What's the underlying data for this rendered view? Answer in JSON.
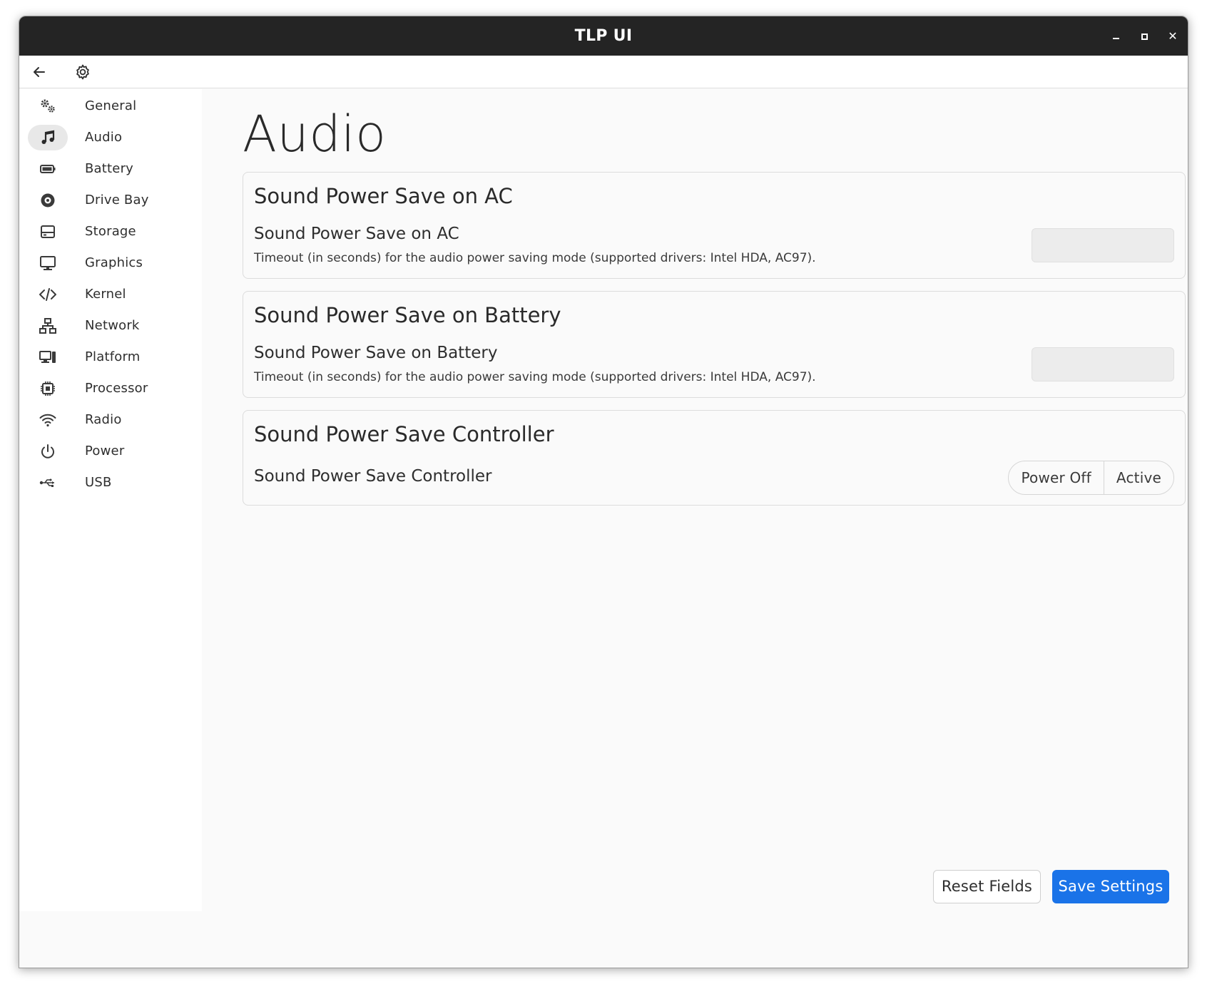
{
  "window": {
    "title": "TLP UI",
    "controls": {
      "minimize_icon": "minimize-icon",
      "maximize_icon": "maximize-icon",
      "close_icon": "close-icon",
      "close_glyph": "✕"
    }
  },
  "toolbar": {
    "back_icon": "arrow-left-icon",
    "settings_icon": "gear-icon"
  },
  "sidebar": {
    "items": [
      {
        "label": "General",
        "icon": "gears-icon"
      },
      {
        "label": "Audio",
        "icon": "music-note-icon",
        "active": true
      },
      {
        "label": "Battery",
        "icon": "battery-icon"
      },
      {
        "label": "Drive Bay",
        "icon": "disc-icon"
      },
      {
        "label": "Storage",
        "icon": "storage-drive-icon"
      },
      {
        "label": "Graphics",
        "icon": "monitor-icon"
      },
      {
        "label": "Kernel",
        "icon": "code-icon"
      },
      {
        "label": "Network",
        "icon": "network-icon"
      },
      {
        "label": "Platform",
        "icon": "desktop-tower-icon"
      },
      {
        "label": "Processor",
        "icon": "chip-icon"
      },
      {
        "label": "Radio",
        "icon": "wifi-icon"
      },
      {
        "label": "Power",
        "icon": "power-icon"
      },
      {
        "label": "USB",
        "icon": "usb-icon"
      }
    ]
  },
  "main": {
    "title": "Audio",
    "cards": [
      {
        "heading": "Sound Power Save on AC",
        "row_title": "Sound Power Save on AC",
        "description": "Timeout (in seconds) for the audio power saving mode (supported drivers: Intel HDA, AC97).",
        "input_value": ""
      },
      {
        "heading": "Sound Power Save on Battery",
        "row_title": "Sound Power Save on Battery",
        "description": "Timeout (in seconds) for the audio power saving mode (supported drivers: Intel HDA, AC97).",
        "input_value": ""
      },
      {
        "heading": "Sound Power Save Controller",
        "row_title": "Sound Power Save Controller",
        "options": [
          "Power Off",
          "Active"
        ]
      }
    ]
  },
  "footer": {
    "reset_label": "Reset Fields",
    "save_label": "Save Settings"
  },
  "colors": {
    "accent": "#1a73e8",
    "titlebar": "#242424",
    "active_item_bg": "#e8e8e8"
  }
}
